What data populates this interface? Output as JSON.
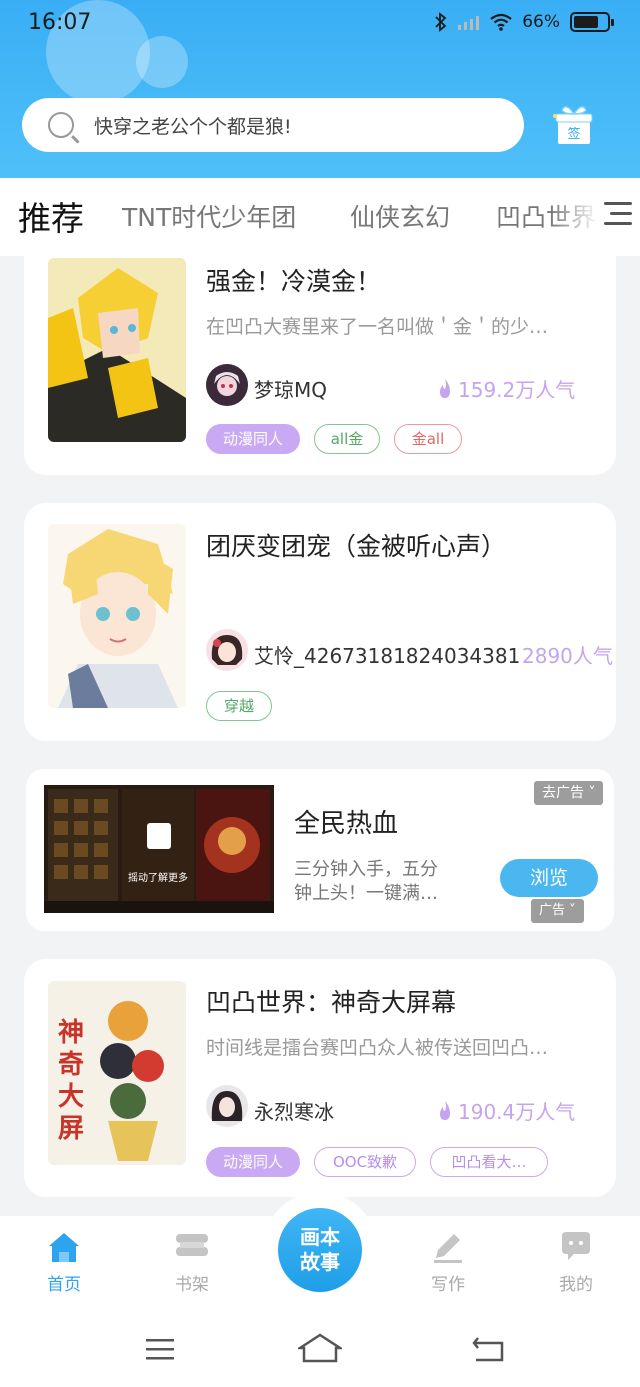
{
  "status_bar": {
    "time": "16:07",
    "battery": "66%"
  },
  "search": {
    "placeholder": "快穿之老公个个都是狼!"
  },
  "tabs": [
    {
      "label": "推荐",
      "active": true
    },
    {
      "label": "TNT时代少年团"
    },
    {
      "label": "仙侠玄幻"
    },
    {
      "label": "凹凸世界"
    }
  ],
  "stories": [
    {
      "title": "强金！冷漠金！",
      "desc": "在凹凸大赛里来了一名叫做＇金＇的少…",
      "author": "梦琼MQ",
      "popularity": "159.2万人气",
      "tags": [
        {
          "label": "动漫同人",
          "style": "fill"
        },
        {
          "label": "all金",
          "style": "green"
        },
        {
          "label": "金all",
          "style": "red"
        }
      ]
    },
    {
      "title": "团厌变团宠（金被听心声）",
      "desc": "",
      "author": "艾怜_42673181824034381",
      "popularity": "2890人气",
      "tags": [
        {
          "label": "穿越",
          "style": "green"
        }
      ]
    },
    {
      "title": "凹凸世界：神奇大屏幕",
      "desc": "时间线是擂台赛凹凸众人被传送回凹凸…",
      "author": "永烈寒冰",
      "popularity": "190.4万人气",
      "tags": [
        {
          "label": "动漫同人",
          "style": "fill"
        },
        {
          "label": "OOC致歉",
          "style": "purple"
        },
        {
          "label": "凹凸看大…",
          "style": "purple"
        }
      ]
    }
  ],
  "ad": {
    "title": "全民热血",
    "desc_line1": "三分钟入手，五分",
    "desc_line2": "钟上头！一键满…",
    "close_label": "去广告 ˅",
    "button_label": "浏览",
    "ad_label": "广告 ˅",
    "image_caption": "摇动了解更多"
  },
  "bottom_nav": [
    {
      "label": "首页",
      "icon": "home-icon",
      "active": true
    },
    {
      "label": "书架",
      "icon": "bookshelf-icon"
    },
    {
      "label": "画本\n故事",
      "icon": "center"
    },
    {
      "label": "写作",
      "icon": "pen-icon"
    },
    {
      "label": "我的",
      "icon": "chat-icon"
    }
  ],
  "center_button": {
    "line1": "画本",
    "line2": "故事"
  },
  "colors": {
    "accent": "#2ea4ee",
    "header": "#3aaef5",
    "tag_purple": "#c9a9f3",
    "popularity": "#c5a4ef"
  }
}
